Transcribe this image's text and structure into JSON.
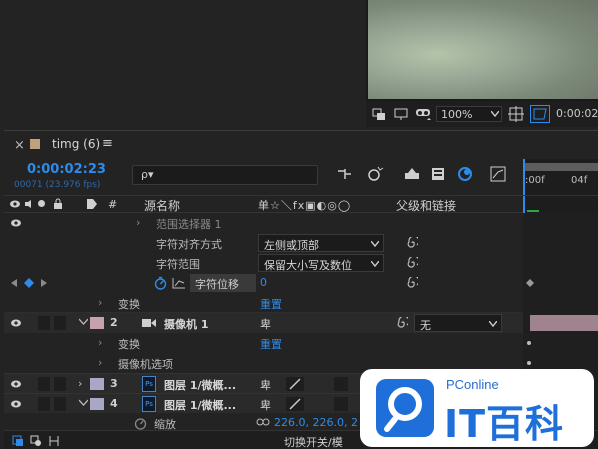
{
  "viewer": {
    "zoom": "100%",
    "timecode_partial": "0:00:02:"
  },
  "tab": {
    "title": "timg (6)",
    "menu_glyph": "≡",
    "close_glyph": "×"
  },
  "timeline": {
    "timecode": "0:00:02:23",
    "frame_info": "00071 (23.976 fps)",
    "search_placeholder": "ρ▾",
    "col_hash": "#",
    "col_source": "源名称",
    "col_switches": "单☆＼fx▣◐◎◯",
    "col_parent": "父级和链接",
    "ruler_0": ":00f",
    "ruler_1": "04f"
  },
  "rows": {
    "range_selector": "范围选择器 1",
    "char_align_label": "字符对齐方式",
    "char_align_value": "左侧或顶部",
    "char_range_label": "字符范围",
    "char_range_value": "保留大小写及数位",
    "char_offset_label": "字符位移",
    "char_offset_value": "0",
    "transform_label": "变换",
    "reset_label": "重置",
    "layer2_num": "2",
    "layer2_name": "摄像机 1",
    "layer2_switch": "卑",
    "layer2_parent": "无",
    "transform2_label": "变换",
    "reset2_label": "重置",
    "camera_options": "摄像机选项",
    "layer3_num": "3",
    "layer3_name": "图层 1/微概...",
    "layer3_switch": "卑",
    "layer4_num": "4",
    "layer4_name": "图层 1/微概...",
    "layer4_switch": "卑",
    "scale_label": "缩放",
    "scale_value": "226.0, 226.0, 2",
    "ps_badge": "Ps"
  },
  "footer": {
    "toggle_label": "切换开关/模"
  },
  "watermark": {
    "brand": "PConline",
    "logo_text": "IT百科"
  },
  "colors": {
    "accent": "#2d8ceb",
    "camera_label": "#c8a1ae",
    "layer_label": "#a9a7c6",
    "tab_label": "#bfa17b",
    "bar": "#9f8490"
  }
}
